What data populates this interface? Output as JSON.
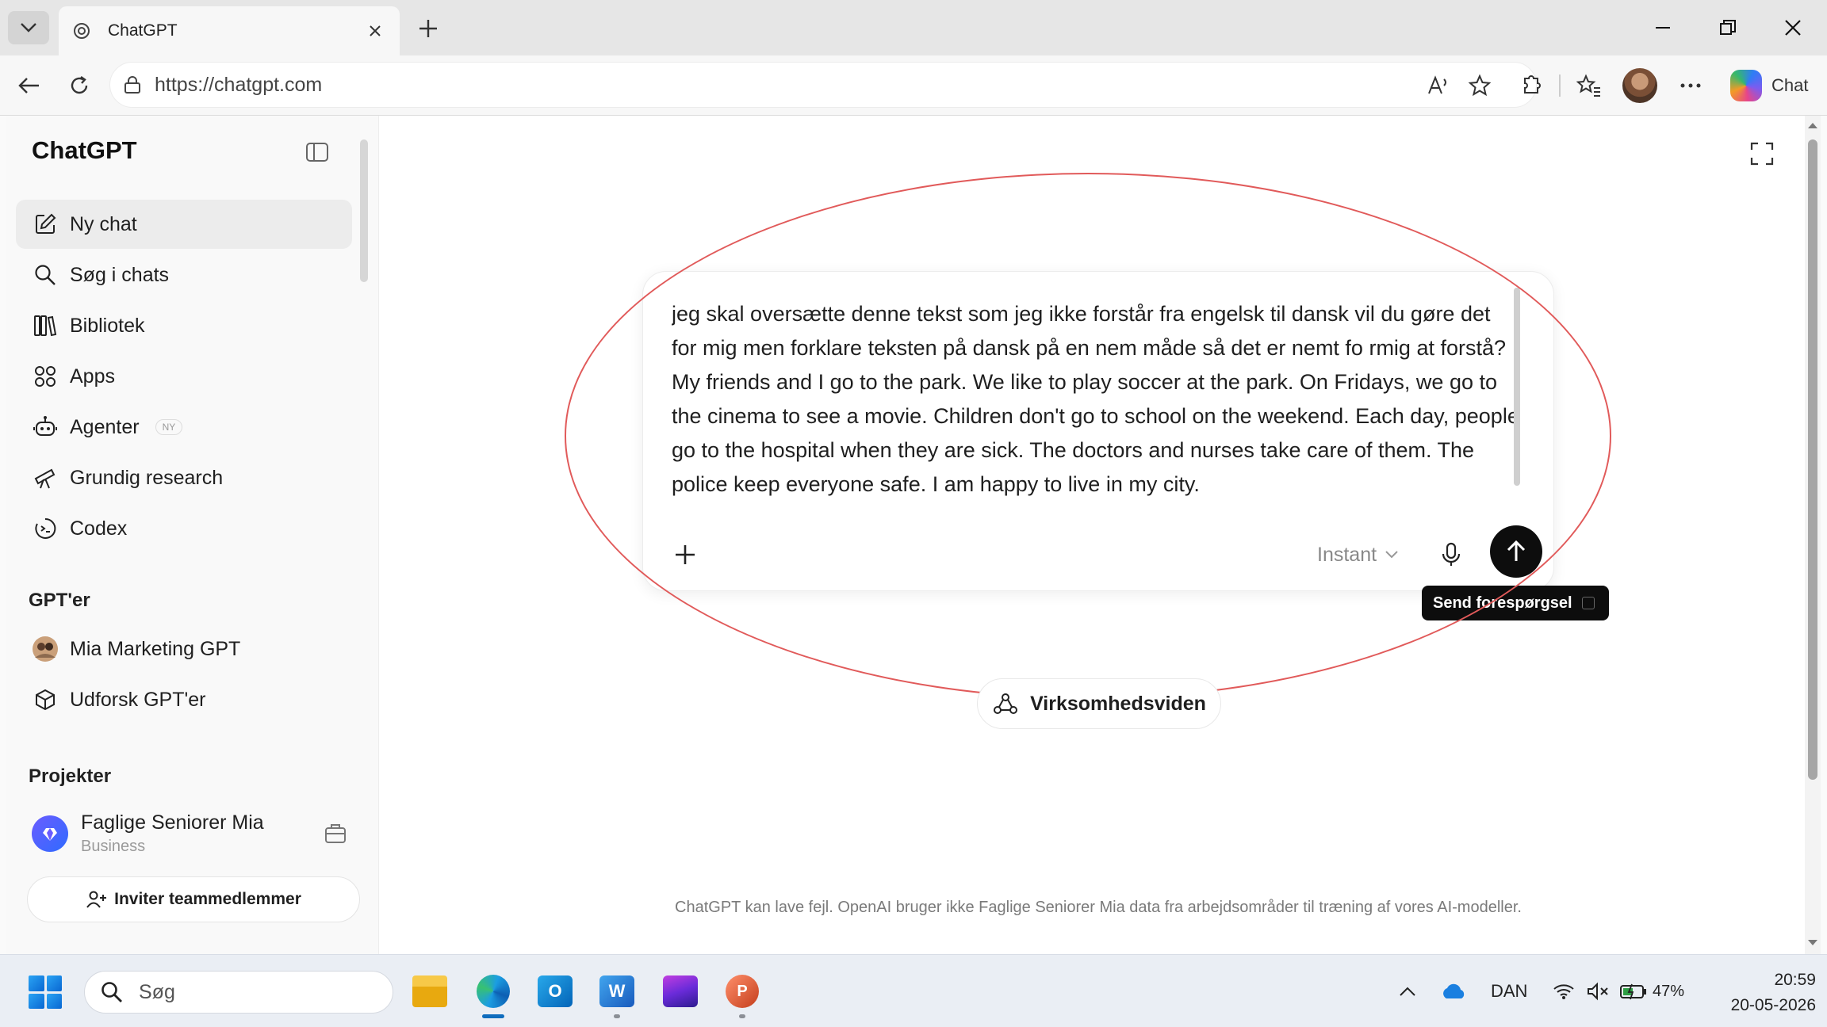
{
  "browser": {
    "tab_title": "ChatGPT",
    "url": "https://chatgpt.com",
    "copilot_label": "Chat"
  },
  "sidebar": {
    "brand": "ChatGPT",
    "items": [
      {
        "label": "Ny chat",
        "icon": "edit-icon"
      },
      {
        "label": "Søg i chats",
        "icon": "search-icon"
      },
      {
        "label": "Bibliotek",
        "icon": "library-icon"
      },
      {
        "label": "Apps",
        "icon": "apps-icon"
      },
      {
        "label": "Agenter",
        "icon": "agent-icon",
        "badge": "NY"
      },
      {
        "label": "Grundig research",
        "icon": "telescope-icon"
      },
      {
        "label": "Codex",
        "icon": "codex-icon"
      }
    ],
    "gpts_heading": "GPT'er",
    "gpts": [
      {
        "label": "Mia Marketing GPT",
        "icon": "gpt-avatar-icon"
      },
      {
        "label": "Udforsk GPT'er",
        "icon": "cube-icon"
      }
    ],
    "projects_heading": "Projekter",
    "workspace": {
      "name": "Faglige Seniorer Mia",
      "plan": "Business"
    },
    "invite_label": "Inviter teammedlemmer"
  },
  "composer": {
    "prompt": "jeg skal oversætte denne tekst som jeg ikke forstår fra engelsk til dansk vil du gøre det for mig men forklare teksten på dansk på en nem måde så det er nemt fo rmig at forstå?\nMy friends and I go to the park. We like to play soccer at the park. On Fridays, we go to the cinema to see a movie. Children don't go to school on the weekend. Each day, people go to the hospital when they are sick. The doctors and nurses take care of them. The police keep everyone safe. I am happy to live in my city.",
    "model_label": "Instant",
    "send_tooltip": "Send forespørgsel"
  },
  "chip": {
    "label": "Virksomhedsviden"
  },
  "disclaimer": "ChatGPT kan lave fejl. OpenAI bruger ikke Faglige Seniorer Mia data fra arbejdsområder til træning af vores AI-modeller.",
  "taskbar": {
    "search_placeholder": "Søg",
    "language": "DAN",
    "battery": "47%",
    "time": "20:59",
    "date": "20-05-2026"
  },
  "colors": {
    "annotation": "#e15a5a",
    "send_button": "#0d0d0d",
    "accent_blue": "#0f6cbd"
  }
}
